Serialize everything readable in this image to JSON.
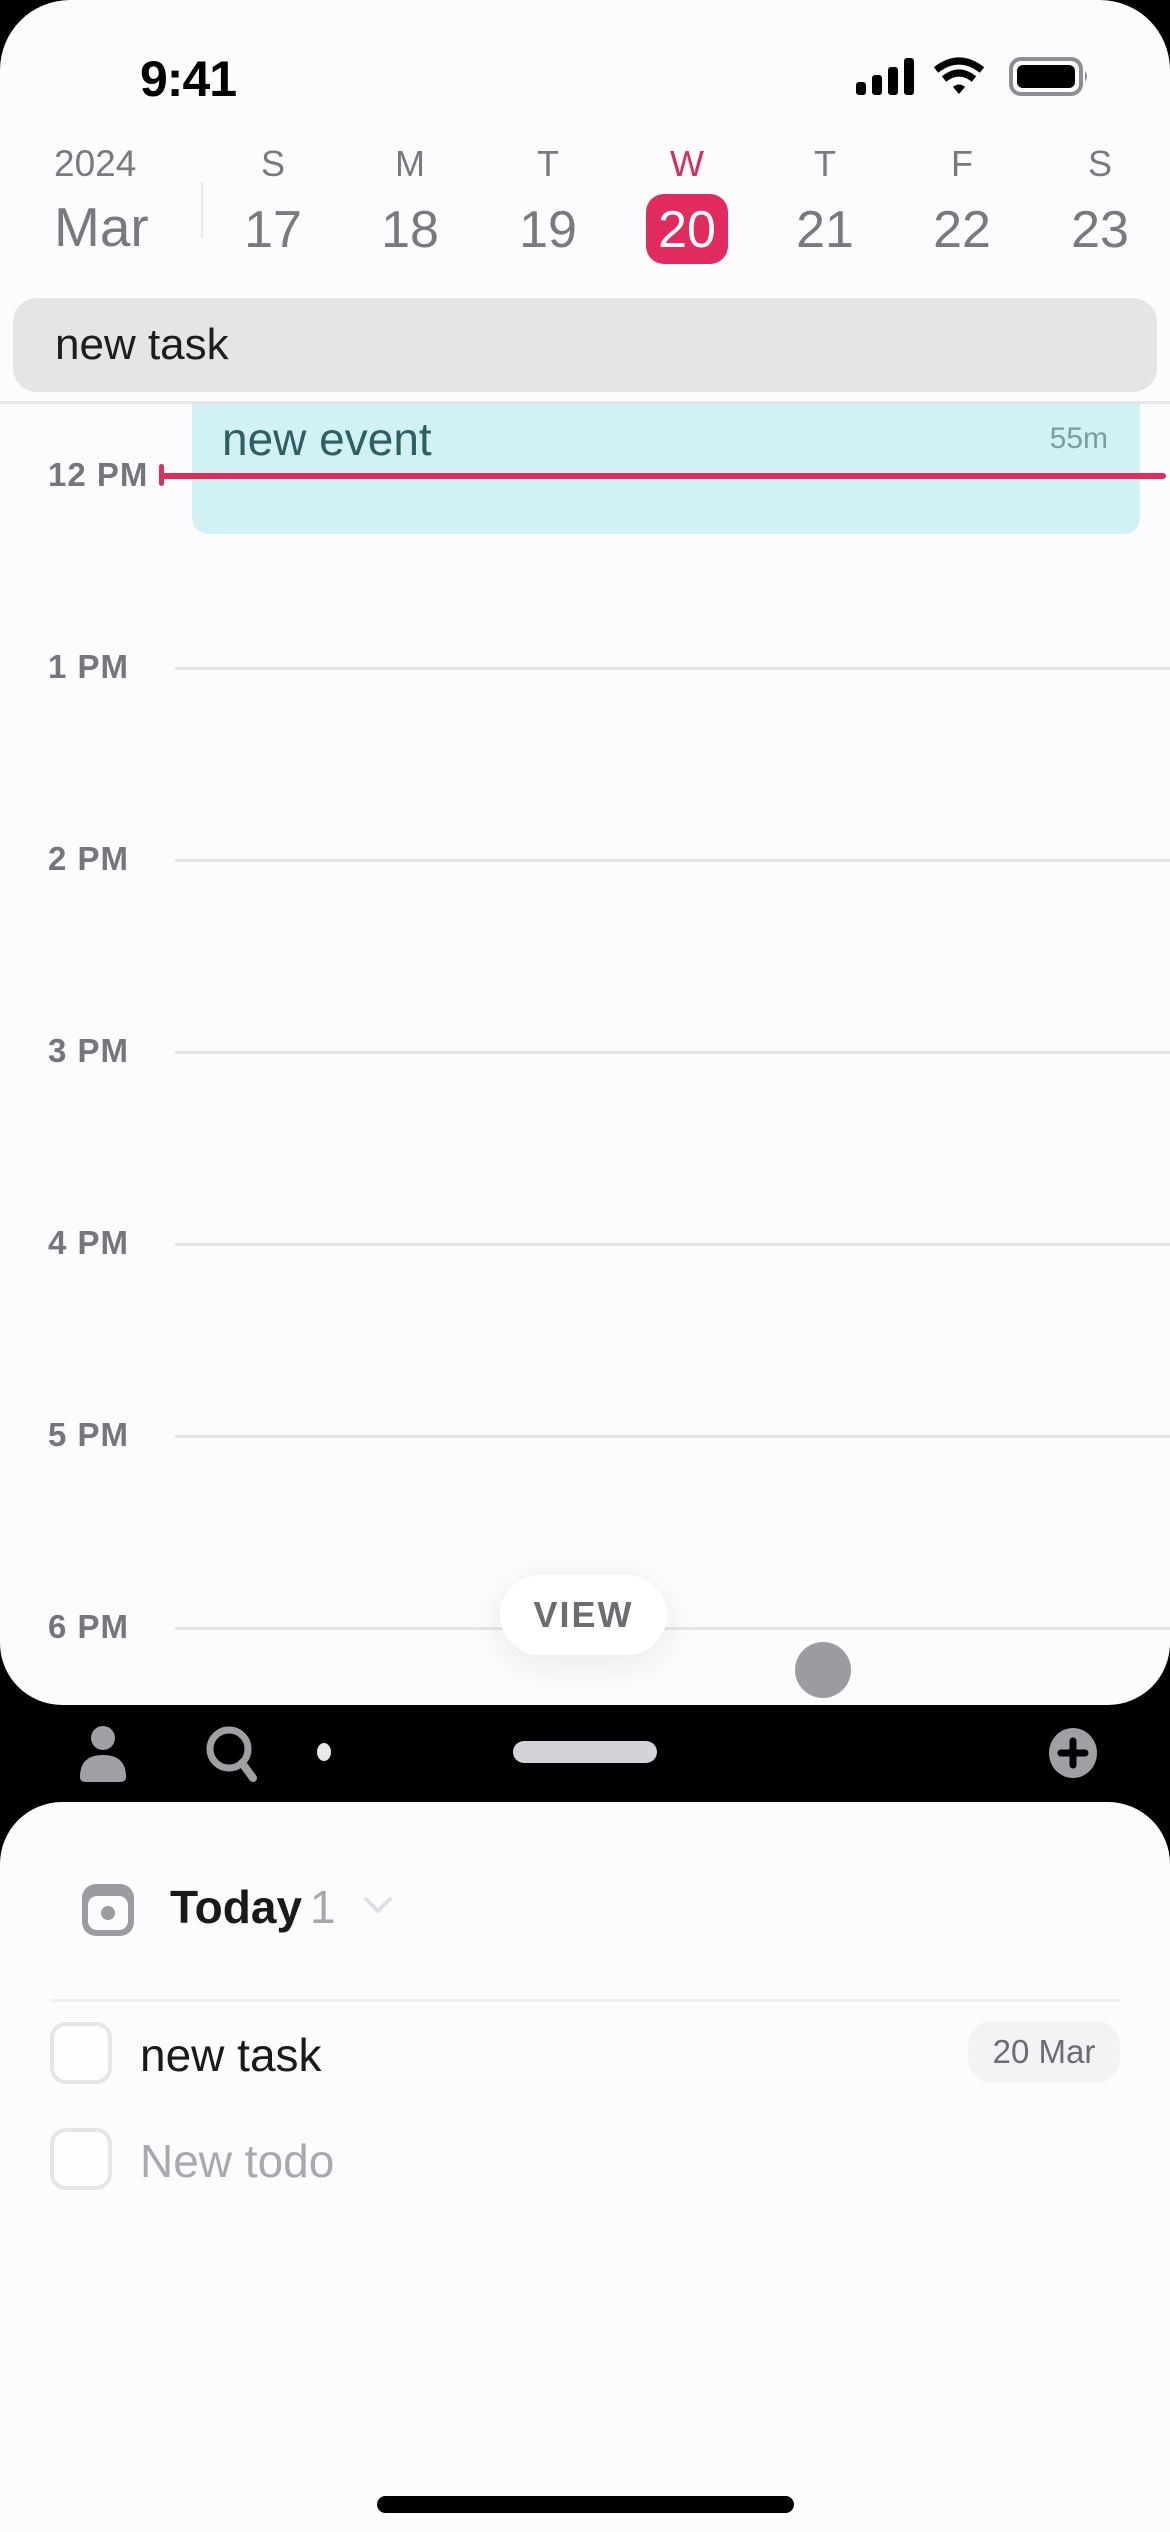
{
  "status_bar": {
    "time": "9:41",
    "icons": [
      "cellular-signal-icon",
      "wifi-icon",
      "battery-icon"
    ]
  },
  "calendar_header": {
    "year": "2024",
    "month": "Mar",
    "days": [
      {
        "letter": "S",
        "number": "17",
        "today": false
      },
      {
        "letter": "M",
        "number": "18",
        "today": false
      },
      {
        "letter": "T",
        "number": "19",
        "today": false
      },
      {
        "letter": "W",
        "number": "20",
        "today": true
      },
      {
        "letter": "T",
        "number": "21",
        "today": false
      },
      {
        "letter": "F",
        "number": "22",
        "today": false
      },
      {
        "letter": "S",
        "number": "23",
        "today": false
      }
    ]
  },
  "all_day": {
    "task_title": "new task"
  },
  "timeline": {
    "hours": [
      "12 PM",
      "1 PM",
      "2 PM",
      "3 PM",
      "4 PM",
      "5 PM",
      "6 PM"
    ],
    "event": {
      "title": "new event",
      "duration": "55m"
    },
    "view_button": "VIEW"
  },
  "toolbar": {
    "icons": [
      "person-icon",
      "search-icon",
      "page-dot-icon",
      "sheet-handle",
      "add-circle-icon"
    ]
  },
  "task_list": {
    "section_title": "Today",
    "section_count": "1",
    "items": [
      {
        "title": "new task",
        "date": "20 Mar",
        "completed": false
      }
    ],
    "new_todo_placeholder": "New todo"
  },
  "colors": {
    "accent": "#e22c5f",
    "event_bg": "#d2f1f5",
    "event_text": "#2e5f62",
    "now_line": "#d9305f"
  }
}
